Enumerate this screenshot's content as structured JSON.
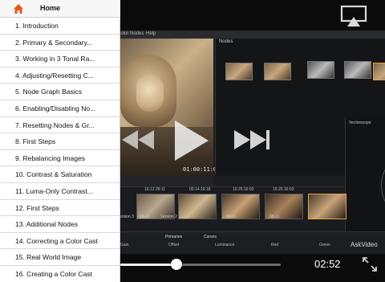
{
  "header": {
    "title": "Home",
    "home_icon": "home-icon",
    "accent_color": "#e8581a"
  },
  "lessons": [
    "1. Introduction",
    "2. Primary & Secondary...",
    "3. Working in 3 Tonal Ra...",
    "4. Adjusting/Resetting C...",
    "5. Node Graph Basics",
    "6. Enabling/Disabling No...",
    "7. Resetting Nodes & Gr...",
    "8. First Steps",
    "9. Rebalancing Images",
    "10. Contrast & Saturation",
    "11. Luma-Only Contrast...",
    "12. First Steps",
    "13. Additional Nodes",
    "14. Correcting a Color Cast",
    "15. Real World Image",
    "16. Creating a Color Cast"
  ],
  "player": {
    "current_time": "02:52",
    "progress": 0.35,
    "icons": [
      "airplay-icon",
      "rewind-icon",
      "play-icon",
      "fast-forward-icon",
      "fullscreen-icon"
    ]
  },
  "video": {
    "menu": [
      "Color",
      "Nodes",
      "Help"
    ],
    "viewer_timecode": "01:00:11:06",
    "nodes_panel_title": "Nodes",
    "scope_title": "Vectorscope",
    "timeline_timecodes": [
      "16:12:28:11",
      "00:14:19:18",
      "15:25:16:03",
      "15:25:16:03"
    ],
    "clip_labels": [
      "Version 3",
      "05 v1",
      "Version 2",
      "05 v1",
      "08 v1"
    ],
    "tabs": [
      "Primaries",
      "Curves"
    ],
    "columns": [
      "Gain",
      "Offset",
      "Luminance",
      "Red",
      "Green"
    ],
    "watermark": "AskVideo"
  }
}
